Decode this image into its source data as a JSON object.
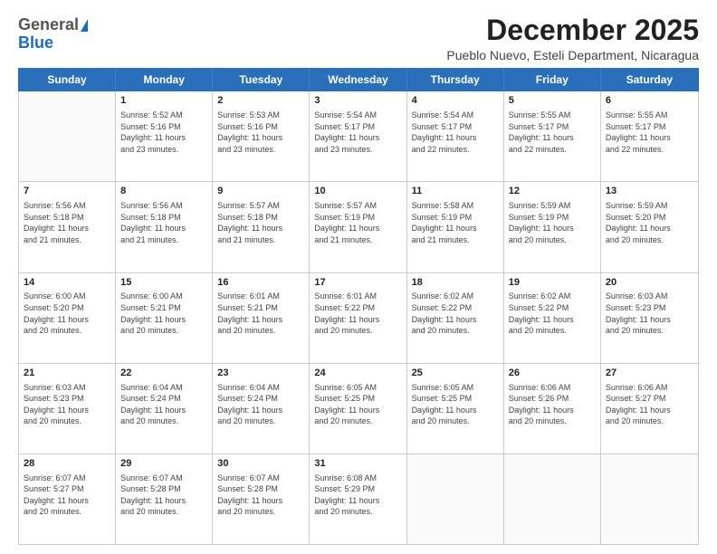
{
  "logo": {
    "general": "General",
    "blue": "Blue"
  },
  "title": "December 2025",
  "subtitle": "Pueblo Nuevo, Esteli Department, Nicaragua",
  "days_of_week": [
    "Sunday",
    "Monday",
    "Tuesday",
    "Wednesday",
    "Thursday",
    "Friday",
    "Saturday"
  ],
  "weeks": [
    [
      {
        "day": "",
        "info": ""
      },
      {
        "day": "1",
        "info": "Sunrise: 5:52 AM\nSunset: 5:16 PM\nDaylight: 11 hours\nand 23 minutes."
      },
      {
        "day": "2",
        "info": "Sunrise: 5:53 AM\nSunset: 5:16 PM\nDaylight: 11 hours\nand 23 minutes."
      },
      {
        "day": "3",
        "info": "Sunrise: 5:54 AM\nSunset: 5:17 PM\nDaylight: 11 hours\nand 23 minutes."
      },
      {
        "day": "4",
        "info": "Sunrise: 5:54 AM\nSunset: 5:17 PM\nDaylight: 11 hours\nand 22 minutes."
      },
      {
        "day": "5",
        "info": "Sunrise: 5:55 AM\nSunset: 5:17 PM\nDaylight: 11 hours\nand 22 minutes."
      },
      {
        "day": "6",
        "info": "Sunrise: 5:55 AM\nSunset: 5:17 PM\nDaylight: 11 hours\nand 22 minutes."
      }
    ],
    [
      {
        "day": "7",
        "info": "Sunrise: 5:56 AM\nSunset: 5:18 PM\nDaylight: 11 hours\nand 21 minutes."
      },
      {
        "day": "8",
        "info": "Sunrise: 5:56 AM\nSunset: 5:18 PM\nDaylight: 11 hours\nand 21 minutes."
      },
      {
        "day": "9",
        "info": "Sunrise: 5:57 AM\nSunset: 5:18 PM\nDaylight: 11 hours\nand 21 minutes."
      },
      {
        "day": "10",
        "info": "Sunrise: 5:57 AM\nSunset: 5:19 PM\nDaylight: 11 hours\nand 21 minutes."
      },
      {
        "day": "11",
        "info": "Sunrise: 5:58 AM\nSunset: 5:19 PM\nDaylight: 11 hours\nand 21 minutes."
      },
      {
        "day": "12",
        "info": "Sunrise: 5:59 AM\nSunset: 5:19 PM\nDaylight: 11 hours\nand 20 minutes."
      },
      {
        "day": "13",
        "info": "Sunrise: 5:59 AM\nSunset: 5:20 PM\nDaylight: 11 hours\nand 20 minutes."
      }
    ],
    [
      {
        "day": "14",
        "info": "Sunrise: 6:00 AM\nSunset: 5:20 PM\nDaylight: 11 hours\nand 20 minutes."
      },
      {
        "day": "15",
        "info": "Sunrise: 6:00 AM\nSunset: 5:21 PM\nDaylight: 11 hours\nand 20 minutes."
      },
      {
        "day": "16",
        "info": "Sunrise: 6:01 AM\nSunset: 5:21 PM\nDaylight: 11 hours\nand 20 minutes."
      },
      {
        "day": "17",
        "info": "Sunrise: 6:01 AM\nSunset: 5:22 PM\nDaylight: 11 hours\nand 20 minutes."
      },
      {
        "day": "18",
        "info": "Sunrise: 6:02 AM\nSunset: 5:22 PM\nDaylight: 11 hours\nand 20 minutes."
      },
      {
        "day": "19",
        "info": "Sunrise: 6:02 AM\nSunset: 5:22 PM\nDaylight: 11 hours\nand 20 minutes."
      },
      {
        "day": "20",
        "info": "Sunrise: 6:03 AM\nSunset: 5:23 PM\nDaylight: 11 hours\nand 20 minutes."
      }
    ],
    [
      {
        "day": "21",
        "info": "Sunrise: 6:03 AM\nSunset: 5:23 PM\nDaylight: 11 hours\nand 20 minutes."
      },
      {
        "day": "22",
        "info": "Sunrise: 6:04 AM\nSunset: 5:24 PM\nDaylight: 11 hours\nand 20 minutes."
      },
      {
        "day": "23",
        "info": "Sunrise: 6:04 AM\nSunset: 5:24 PM\nDaylight: 11 hours\nand 20 minutes."
      },
      {
        "day": "24",
        "info": "Sunrise: 6:05 AM\nSunset: 5:25 PM\nDaylight: 11 hours\nand 20 minutes."
      },
      {
        "day": "25",
        "info": "Sunrise: 6:05 AM\nSunset: 5:25 PM\nDaylight: 11 hours\nand 20 minutes."
      },
      {
        "day": "26",
        "info": "Sunrise: 6:06 AM\nSunset: 5:26 PM\nDaylight: 11 hours\nand 20 minutes."
      },
      {
        "day": "27",
        "info": "Sunrise: 6:06 AM\nSunset: 5:27 PM\nDaylight: 11 hours\nand 20 minutes."
      }
    ],
    [
      {
        "day": "28",
        "info": "Sunrise: 6:07 AM\nSunset: 5:27 PM\nDaylight: 11 hours\nand 20 minutes."
      },
      {
        "day": "29",
        "info": "Sunrise: 6:07 AM\nSunset: 5:28 PM\nDaylight: 11 hours\nand 20 minutes."
      },
      {
        "day": "30",
        "info": "Sunrise: 6:07 AM\nSunset: 5:28 PM\nDaylight: 11 hours\nand 20 minutes."
      },
      {
        "day": "31",
        "info": "Sunrise: 6:08 AM\nSunset: 5:29 PM\nDaylight: 11 hours\nand 20 minutes."
      },
      {
        "day": "",
        "info": ""
      },
      {
        "day": "",
        "info": ""
      },
      {
        "day": "",
        "info": ""
      }
    ]
  ]
}
